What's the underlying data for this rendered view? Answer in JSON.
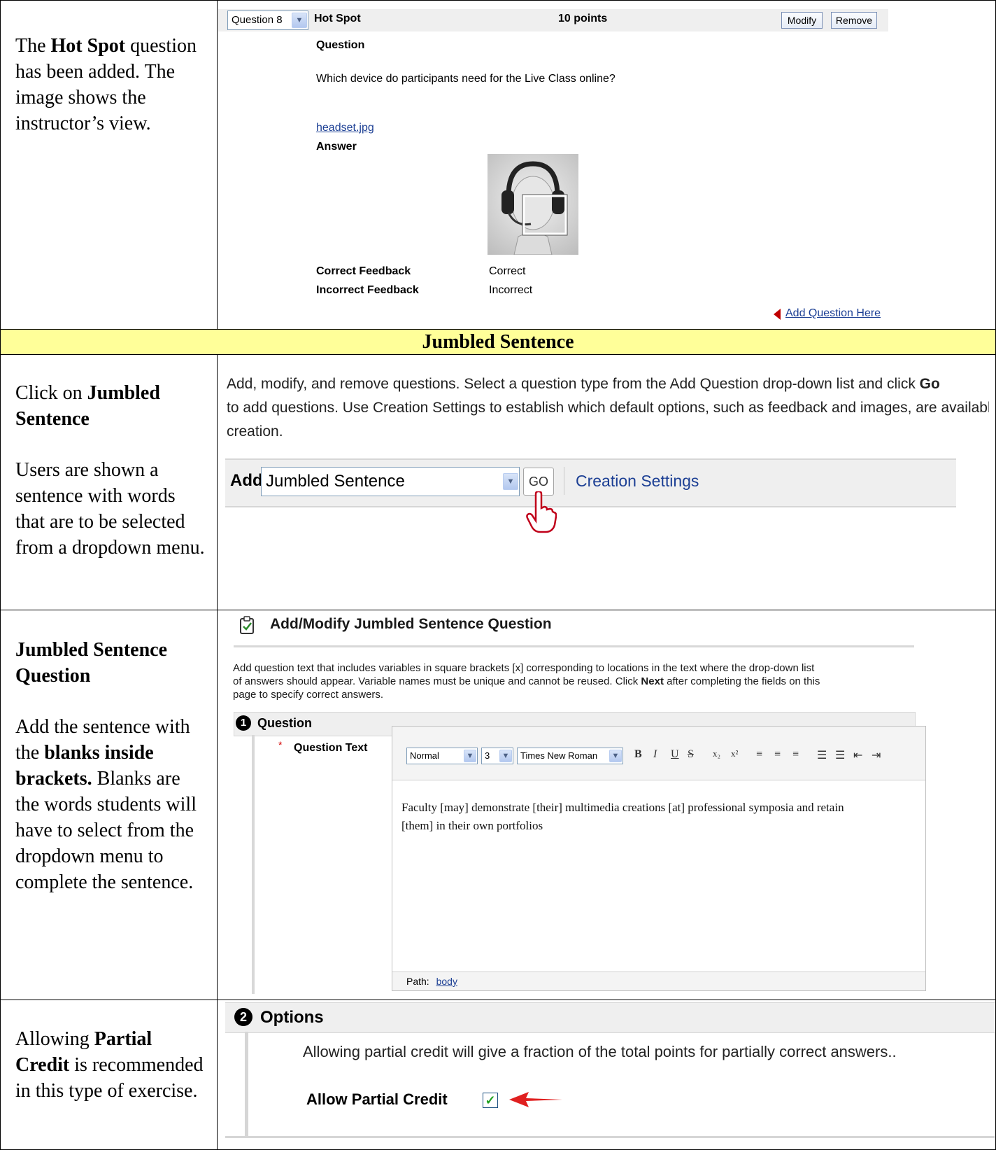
{
  "hotspot_step": {
    "text_parts": [
      "The ",
      "Hot Spot",
      " question has been added. The image shows the instructor’s view."
    ],
    "question_select": "Question 8",
    "question_type": "Hot Spot",
    "points": "10 points",
    "modify_label": "Modify",
    "remove_label": "Remove",
    "question_heading": "Question",
    "question_text": "Which device do participants need for the Live Class online?",
    "image_link": "headset.jpg",
    "answer_heading": "Answer",
    "correct_feedback_label": "Correct Feedback",
    "correct_feedback_value": "Correct",
    "incorrect_feedback_label": "Incorrect Feedback",
    "incorrect_feedback_value": "Incorrect",
    "add_question_here": "Add Question Here"
  },
  "banner": "Jumbled Sentence",
  "click_step": {
    "title_prefix": "Click on ",
    "title_bold": "Jumbled Sentence",
    "body": "Users are shown a sentence with words that are to be selected from a dropdown menu.",
    "instruction_1": "Add, modify, and remove questions. Select a question type from the Add Question drop-down list and click ",
    "instruction_go": "Go",
    "instruction_2": " to add questions. Use Creation Settings to establish which default options, such as feedback and images, are available for questi",
    "instruction_3": "creation.",
    "add_label": "Add",
    "add_select": "Jumbled Sentence",
    "go_label": "GO",
    "creation_settings": "Creation Settings"
  },
  "question_step": {
    "title": "Jumbled Sentence Question",
    "body_1": "Add the sentence with the ",
    "body_bold": "blanks inside brackets.",
    "body_2": " Blanks are the words students will have to select from the dropdown menu to complete the sentence.",
    "form_title": "Add/Modify Jumbled Sentence Question",
    "help_1": "Add question text that includes variables in square brackets [x] corresponding to locations in the text where the drop-down list",
    "help_2a": "of answers should appear. Variable names must be unique and cannot be reused. Click ",
    "help_next": "Next",
    "help_2b": " after completing the fields on this",
    "help_3": "page to specify correct answers.",
    "section_number": "1",
    "section_title": "Question",
    "required_mark": "*",
    "field_label": "Question Text",
    "format_select": "Normal",
    "size_select": "3",
    "font_select": "Times New Roman",
    "editor_line_1": "Faculty [may] demonstrate [their] multimedia creations [at] professional symposia and retain",
    "editor_line_2": "[them] in their own portfolios",
    "path_label": "Path:",
    "path_value": "body"
  },
  "options_step": {
    "body_1": "Allowing ",
    "body_bold": "Partial Credit",
    "body_2": " is recommended in this type of exercise.",
    "section_number": "2",
    "section_title": "Options",
    "description": "Allowing partial credit will give a fraction of the total points for partially correct answers..",
    "checkbox_label": "Allow Partial Credit",
    "checked": true
  },
  "colors": {
    "banner": "#ffff99",
    "link": "#1c3f94",
    "arrow": "#e02020"
  }
}
